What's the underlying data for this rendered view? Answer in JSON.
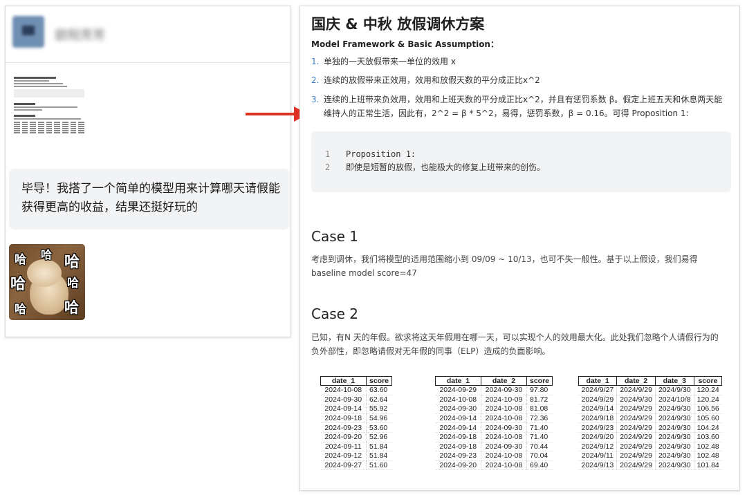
{
  "chat": {
    "name": "欧阳芳芳",
    "message": "毕导！我搭了一个简单的模型用来计算哪天请假能获得更高的收益，结果还挺好玩的",
    "sticker_text": [
      "哈",
      "哈",
      "哈",
      "哈",
      "哈",
      "哈",
      "哈"
    ]
  },
  "doc": {
    "title": "国庆 & 中秋 放假调休方案",
    "subtitle": "Model Framework & Basic Assumption：",
    "list": [
      {
        "num": "1.",
        "text": "单独的一天放假带来一单位的效用 x"
      },
      {
        "num": "2.",
        "text": "连续的放假带来正效用，效用和放假天数的平分成正比x^2"
      },
      {
        "num": "3.",
        "text": "连续的上班带来负效用，效用和上班天数的平分成正比x^2，并且有惩罚系数 β。假定上班五天和休息两天能维持人的正常生活，因此有，2^2 = β * 5^2，易得，惩罚系数，β = 0.16。可得 Proposition 1:"
      }
    ],
    "code": [
      {
        "ln": "1",
        "text": "Proposition 1:"
      },
      {
        "ln": "2",
        "text": "即使是短暂的放假，也能极大的修复上班带来的创伤。"
      }
    ],
    "case1": {
      "heading": "Case 1",
      "text": "考虑到调休，我们将模型的适用范围缩小到 09/09 ~ 10/13，也可不失一般性。基于以上假设，我们易得 baseline model score=47"
    },
    "case2": {
      "heading": "Case 2",
      "text": "已知，有N 天的年假。欲求将这天年假用在哪一天，可以实现个人的效用最大化。此处我们忽略个人请假行为的负外部性，即忽略请假对无年假的同事（ELP）造成的负面影响。"
    },
    "table1": {
      "headers": [
        "date_1",
        "score"
      ],
      "rows": [
        [
          "2024-10-08",
          "63.60"
        ],
        [
          "2024-09-30",
          "62.64"
        ],
        [
          "2024-09-14",
          "55.92"
        ],
        [
          "2024-09-18",
          "54.96"
        ],
        [
          "2024-09-23",
          "53.60"
        ],
        [
          "2024-09-20",
          "52.96"
        ],
        [
          "2024-09-11",
          "51.84"
        ],
        [
          "2024-09-12",
          "51.84"
        ],
        [
          "2024-09-27",
          "51.60"
        ]
      ]
    },
    "table2": {
      "headers": [
        "date_1",
        "date_2",
        "score"
      ],
      "rows": [
        [
          "2024-09-29",
          "2024-09-30",
          "97.80"
        ],
        [
          "2024-10-08",
          "2024-10-09",
          "81.72"
        ],
        [
          "2024-09-30",
          "2024-10-08",
          "81.08"
        ],
        [
          "2024-09-14",
          "2024-10-08",
          "72.36"
        ],
        [
          "2024-09-14",
          "2024-09-30",
          "71.40"
        ],
        [
          "2024-09-18",
          "2024-10-08",
          "71.40"
        ],
        [
          "2024-09-18",
          "2024-09-30",
          "70.44"
        ],
        [
          "2024-09-23",
          "2024-10-08",
          "70.04"
        ],
        [
          "2024-09-20",
          "2024-10-08",
          "69.40"
        ]
      ]
    },
    "table3": {
      "headers": [
        "date_1",
        "date_2",
        "date_3",
        "score"
      ],
      "rows": [
        [
          "2024/9/27",
          "2024/9/29",
          "2024/9/30",
          "120.24"
        ],
        [
          "2024/9/29",
          "2024/9/30",
          "2024/10/8",
          "120.24"
        ],
        [
          "2024/9/14",
          "2024/9/29",
          "2024/9/30",
          "106.56"
        ],
        [
          "2024/9/18",
          "2024/9/29",
          "2024/9/30",
          "105.60"
        ],
        [
          "2024/9/23",
          "2024/9/29",
          "2024/9/30",
          "104.24"
        ],
        [
          "2024/9/20",
          "2024/9/29",
          "2024/9/30",
          "103.60"
        ],
        [
          "2024/9/12",
          "2024/9/29",
          "2024/9/30",
          "102.48"
        ],
        [
          "2024/9/11",
          "2024/9/29",
          "2024/9/30",
          "102.48"
        ],
        [
          "2024/9/13",
          "2024/9/29",
          "2024/9/30",
          "101.84"
        ]
      ]
    }
  },
  "colors": {
    "arrow": "#e03224",
    "list_number": "#3d7fc7",
    "bubble_bg": "#f2f3f5"
  }
}
